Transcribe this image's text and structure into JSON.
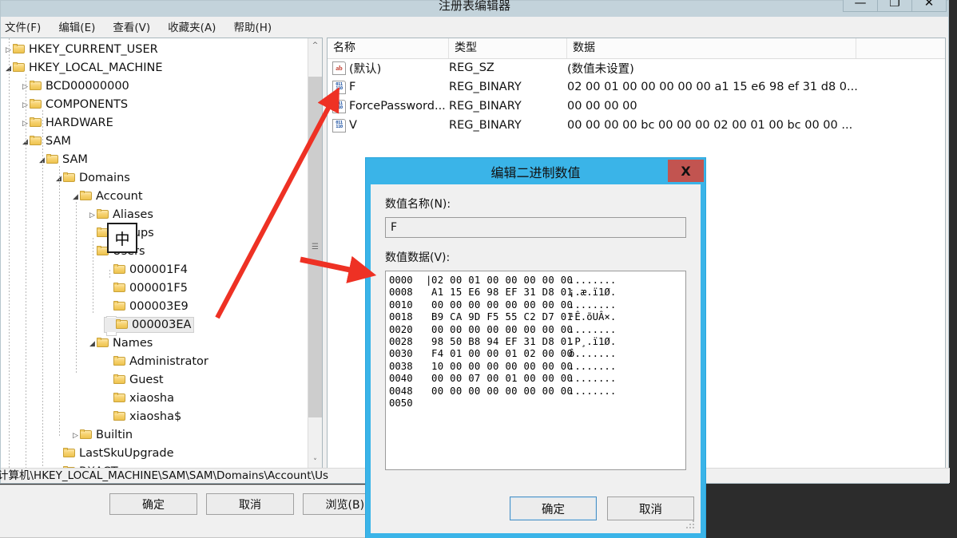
{
  "window": {
    "title": "注册表编辑器",
    "buttons": {
      "minimize": "—",
      "maximize": "❐",
      "close": "✕"
    },
    "menu": [
      "文件(F)",
      "编辑(E)",
      "查看(V)",
      "收藏夹(A)",
      "帮助(H)"
    ],
    "status_path": "计算机\\HKEY_LOCAL_MACHINE\\SAM\\SAM\\Domains\\Account\\Us"
  },
  "ime": {
    "label": "中"
  },
  "tree": [
    {
      "label": "HKEY_CURRENT_USER",
      "depth": 1,
      "expander": "▷",
      "selected": false
    },
    {
      "label": "HKEY_LOCAL_MACHINE",
      "depth": 1,
      "expander": "◢",
      "selected": false
    },
    {
      "label": "BCD00000000",
      "depth": 2,
      "expander": "▷",
      "selected": false
    },
    {
      "label": "COMPONENTS",
      "depth": 2,
      "expander": "▷",
      "selected": false
    },
    {
      "label": "HARDWARE",
      "depth": 2,
      "expander": "▷",
      "selected": false
    },
    {
      "label": "SAM",
      "depth": 2,
      "expander": "◢",
      "selected": false
    },
    {
      "label": "SAM",
      "depth": 3,
      "expander": "◢",
      "selected": false
    },
    {
      "label": "Domains",
      "depth": 4,
      "expander": "◢",
      "selected": false
    },
    {
      "label": "Account",
      "depth": 5,
      "expander": "◢",
      "selected": false
    },
    {
      "label": "Aliases",
      "depth": 6,
      "expander": "▷",
      "selected": false
    },
    {
      "label": "Groups",
      "depth": 6,
      "expander": "",
      "selected": false
    },
    {
      "label": "Users",
      "depth": 6,
      "expander": "",
      "selected": false
    },
    {
      "label": "000001F4",
      "depth": 7,
      "expander": "",
      "selected": false
    },
    {
      "label": "000001F5",
      "depth": 7,
      "expander": "",
      "selected": false
    },
    {
      "label": "000003E9",
      "depth": 7,
      "expander": "",
      "selected": false
    },
    {
      "label": "000003EA",
      "depth": 7,
      "expander": "",
      "selected": true
    },
    {
      "label": "Names",
      "depth": 6,
      "expander": "◢",
      "selected": false
    },
    {
      "label": "Administrator",
      "depth": 7,
      "expander": "",
      "selected": false
    },
    {
      "label": "Guest",
      "depth": 7,
      "expander": "",
      "selected": false
    },
    {
      "label": "xiaosha",
      "depth": 7,
      "expander": "",
      "selected": false
    },
    {
      "label": "xiaosha$",
      "depth": 7,
      "expander": "",
      "selected": false
    },
    {
      "label": "Builtin",
      "depth": 5,
      "expander": "▷",
      "selected": false
    },
    {
      "label": "LastSkuUpgrade",
      "depth": 4,
      "expander": "",
      "selected": false
    },
    {
      "label": "RXACT",
      "depth": 4,
      "expander": "",
      "selected": false
    }
  ],
  "value_list": {
    "headers": [
      "名称",
      "类型",
      "数据"
    ],
    "rows": [
      {
        "icon": "string-value-icon",
        "name": "(默认)",
        "type": "REG_SZ",
        "data": "(数值未设置)"
      },
      {
        "icon": "binary-value-icon",
        "name": "F",
        "type": "REG_BINARY",
        "data": "02 00 01 00 00 00 00 00 a1 15 e6 98 ef 31 d8 0..."
      },
      {
        "icon": "binary-value-icon",
        "name": "ForcePassword...",
        "type": "REG_BINARY",
        "data": "00 00 00 00"
      },
      {
        "icon": "binary-value-icon",
        "name": "V",
        "type": "REG_BINARY",
        "data": "00 00 00 00 bc 00 00 00 02 00 01 00 bc 00 00 ..."
      }
    ]
  },
  "dialog": {
    "title": "编辑二进制数值",
    "close_label": "X",
    "name_label": "数值名称(N):",
    "name_value": "F",
    "data_label": "数值数据(V):",
    "hex_rows": [
      {
        "offset": "0000",
        "bytes": "02 00 01 00 00 00 00 00",
        "ascii": "........"
      },
      {
        "offset": "0008",
        "bytes": "A1 15 E6 98 EF 31 D8 01",
        "ascii": "¡.æ.ï1Ø."
      },
      {
        "offset": "0010",
        "bytes": "00 00 00 00 00 00 00 00",
        "ascii": "........"
      },
      {
        "offset": "0018",
        "bytes": "B9 CA 9D F5 55 C2 D7 01",
        "ascii": "¹Ê.õUÂ×."
      },
      {
        "offset": "0020",
        "bytes": "00 00 00 00 00 00 00 00",
        "ascii": "........"
      },
      {
        "offset": "0028",
        "bytes": "98 50 B8 94 EF 31 D8 01",
        "ascii": ".P¸.ï1Ø."
      },
      {
        "offset": "0030",
        "bytes": "F4 01 00 00 01 02 00 00",
        "ascii": "ô......."
      },
      {
        "offset": "0038",
        "bytes": "10 00 00 00 00 00 00 00",
        "ascii": "........"
      },
      {
        "offset": "0040",
        "bytes": "00 00 07 00 01 00 00 00",
        "ascii": "........"
      },
      {
        "offset": "0048",
        "bytes": "00 00 00 00 00 00 00 00",
        "ascii": "........"
      },
      {
        "offset": "0050",
        "bytes": "",
        "ascii": ""
      }
    ],
    "ok_label": "确定",
    "cancel_label": "取消"
  },
  "background_dialog": {
    "ok_label": "确定",
    "cancel_label": "取消",
    "browse_label": "浏览(B)."
  },
  "annotations": {
    "arrow_color": "#ee3124",
    "arrows": [
      {
        "name": "arrow-key-to-dialog",
        "from": "000001F4 tree node",
        "to": "编辑二进制数值 dialog"
      },
      {
        "name": "arrow-key-to-value",
        "from": "000003EA tree node",
        "to": "F value row"
      }
    ]
  },
  "colors": {
    "titlebar": "#c3d3db",
    "dialog_frame": "#3ab4e8",
    "dialog_close": "#c25450",
    "desktop": "#2c2c2c",
    "folder": "#f4cf68"
  }
}
